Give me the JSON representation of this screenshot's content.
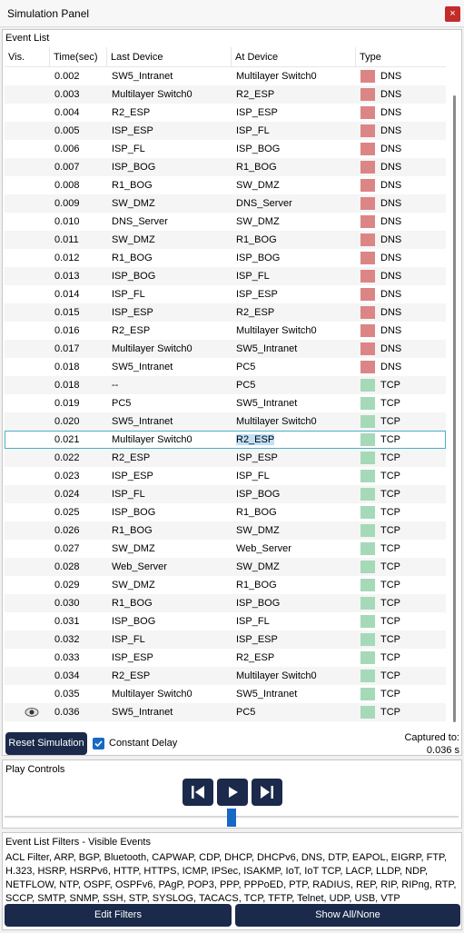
{
  "window": {
    "title": "Simulation Panel",
    "close_glyph": "×"
  },
  "event_list": {
    "title": "Event List",
    "columns": {
      "vis": "Vis.",
      "time": "Time(sec)",
      "last": "Last Device",
      "at": "At Device",
      "type": "Type"
    },
    "type_colors": {
      "DNS": "#dc8585",
      "TCP": "#a6d9b8"
    },
    "rows": [
      {
        "time": "0.002",
        "last": "SW5_Intranet",
        "at": "Multilayer Switch0",
        "type": "DNS"
      },
      {
        "time": "0.003",
        "last": "Multilayer Switch0",
        "at": "R2_ESP",
        "type": "DNS"
      },
      {
        "time": "0.004",
        "last": "R2_ESP",
        "at": "ISP_ESP",
        "type": "DNS"
      },
      {
        "time": "0.005",
        "last": "ISP_ESP",
        "at": "ISP_FL",
        "type": "DNS"
      },
      {
        "time": "0.006",
        "last": "ISP_FL",
        "at": "ISP_BOG",
        "type": "DNS"
      },
      {
        "time": "0.007",
        "last": "ISP_BOG",
        "at": "R1_BOG",
        "type": "DNS"
      },
      {
        "time": "0.008",
        "last": "R1_BOG",
        "at": "SW_DMZ",
        "type": "DNS"
      },
      {
        "time": "0.009",
        "last": "SW_DMZ",
        "at": "DNS_Server",
        "type": "DNS"
      },
      {
        "time": "0.010",
        "last": "DNS_Server",
        "at": "SW_DMZ",
        "type": "DNS"
      },
      {
        "time": "0.011",
        "last": "SW_DMZ",
        "at": "R1_BOG",
        "type": "DNS"
      },
      {
        "time": "0.012",
        "last": "R1_BOG",
        "at": "ISP_BOG",
        "type": "DNS"
      },
      {
        "time": "0.013",
        "last": "ISP_BOG",
        "at": "ISP_FL",
        "type": "DNS"
      },
      {
        "time": "0.014",
        "last": "ISP_FL",
        "at": "ISP_ESP",
        "type": "DNS"
      },
      {
        "time": "0.015",
        "last": "ISP_ESP",
        "at": "R2_ESP",
        "type": "DNS"
      },
      {
        "time": "0.016",
        "last": "R2_ESP",
        "at": "Multilayer Switch0",
        "type": "DNS"
      },
      {
        "time": "0.017",
        "last": "Multilayer Switch0",
        "at": "SW5_Intranet",
        "type": "DNS"
      },
      {
        "time": "0.018",
        "last": "SW5_Intranet",
        "at": "PC5",
        "type": "DNS"
      },
      {
        "time": "0.018",
        "last": "--",
        "at": "PC5",
        "type": "TCP"
      },
      {
        "time": "0.019",
        "last": "PC5",
        "at": "SW5_Intranet",
        "type": "TCP"
      },
      {
        "time": "0.020",
        "last": "SW5_Intranet",
        "at": "Multilayer Switch0",
        "type": "TCP"
      },
      {
        "time": "0.021",
        "last": "Multilayer Switch0",
        "at": "R2_ESP",
        "type": "TCP",
        "selected": true
      },
      {
        "time": "0.022",
        "last": "R2_ESP",
        "at": "ISP_ESP",
        "type": "TCP"
      },
      {
        "time": "0.023",
        "last": "ISP_ESP",
        "at": "ISP_FL",
        "type": "TCP"
      },
      {
        "time": "0.024",
        "last": "ISP_FL",
        "at": "ISP_BOG",
        "type": "TCP"
      },
      {
        "time": "0.025",
        "last": "ISP_BOG",
        "at": "R1_BOG",
        "type": "TCP"
      },
      {
        "time": "0.026",
        "last": "R1_BOG",
        "at": "SW_DMZ",
        "type": "TCP"
      },
      {
        "time": "0.027",
        "last": "SW_DMZ",
        "at": "Web_Server",
        "type": "TCP"
      },
      {
        "time": "0.028",
        "last": "Web_Server",
        "at": "SW_DMZ",
        "type": "TCP"
      },
      {
        "time": "0.029",
        "last": "SW_DMZ",
        "at": "R1_BOG",
        "type": "TCP"
      },
      {
        "time": "0.030",
        "last": "R1_BOG",
        "at": "ISP_BOG",
        "type": "TCP"
      },
      {
        "time": "0.031",
        "last": "ISP_BOG",
        "at": "ISP_FL",
        "type": "TCP"
      },
      {
        "time": "0.032",
        "last": "ISP_FL",
        "at": "ISP_ESP",
        "type": "TCP"
      },
      {
        "time": "0.033",
        "last": "ISP_ESP",
        "at": "R2_ESP",
        "type": "TCP"
      },
      {
        "time": "0.034",
        "last": "R2_ESP",
        "at": "Multilayer Switch0",
        "type": "TCP"
      },
      {
        "time": "0.035",
        "last": "Multilayer Switch0",
        "at": "SW5_Intranet",
        "type": "TCP"
      },
      {
        "time": "0.036",
        "last": "SW5_Intranet",
        "at": "PC5",
        "type": "TCP",
        "vis_icon": "eye-icon"
      }
    ],
    "reset_label": "Reset Simulation",
    "constant_delay_label": "Constant Delay",
    "constant_delay_checked": true,
    "captured_label": "Captured to:",
    "captured_value": "0.036 s"
  },
  "play_controls": {
    "title": "Play Controls",
    "buttons": [
      "skip-back-icon",
      "play-icon",
      "skip-forward-icon"
    ],
    "slider_fraction": 0.5
  },
  "filters": {
    "title": "Event List Filters - Visible Events",
    "list": "ACL Filter, ARP, BGP, Bluetooth, CAPWAP, CDP, DHCP, DHCPv6, DNS, DTP, EAPOL, EIGRP, FTP, H.323, HSRP, HSRPv6, HTTP, HTTPS, ICMP, IPSec, ISAKMP, IoT, IoT TCP, LACP, LLDP, NDP, NETFLOW, NTP, OSPF, OSPFv6, PAgP, POP3, PPP, PPPoED, PTP, RADIUS, REP, RIP, RIPng, RTP, SCCP, SMTP, SNMP, SSH, STP, SYSLOG, TACACS, TCP, TFTP, Telnet, UDP, USB, VTP",
    "edit_label": "Edit Filters",
    "show_all_label": "Show All/None"
  },
  "colors": {
    "button_dark": "#1b2a4a",
    "accent_blue": "#1769c6",
    "close_red": "#c42b2b"
  }
}
